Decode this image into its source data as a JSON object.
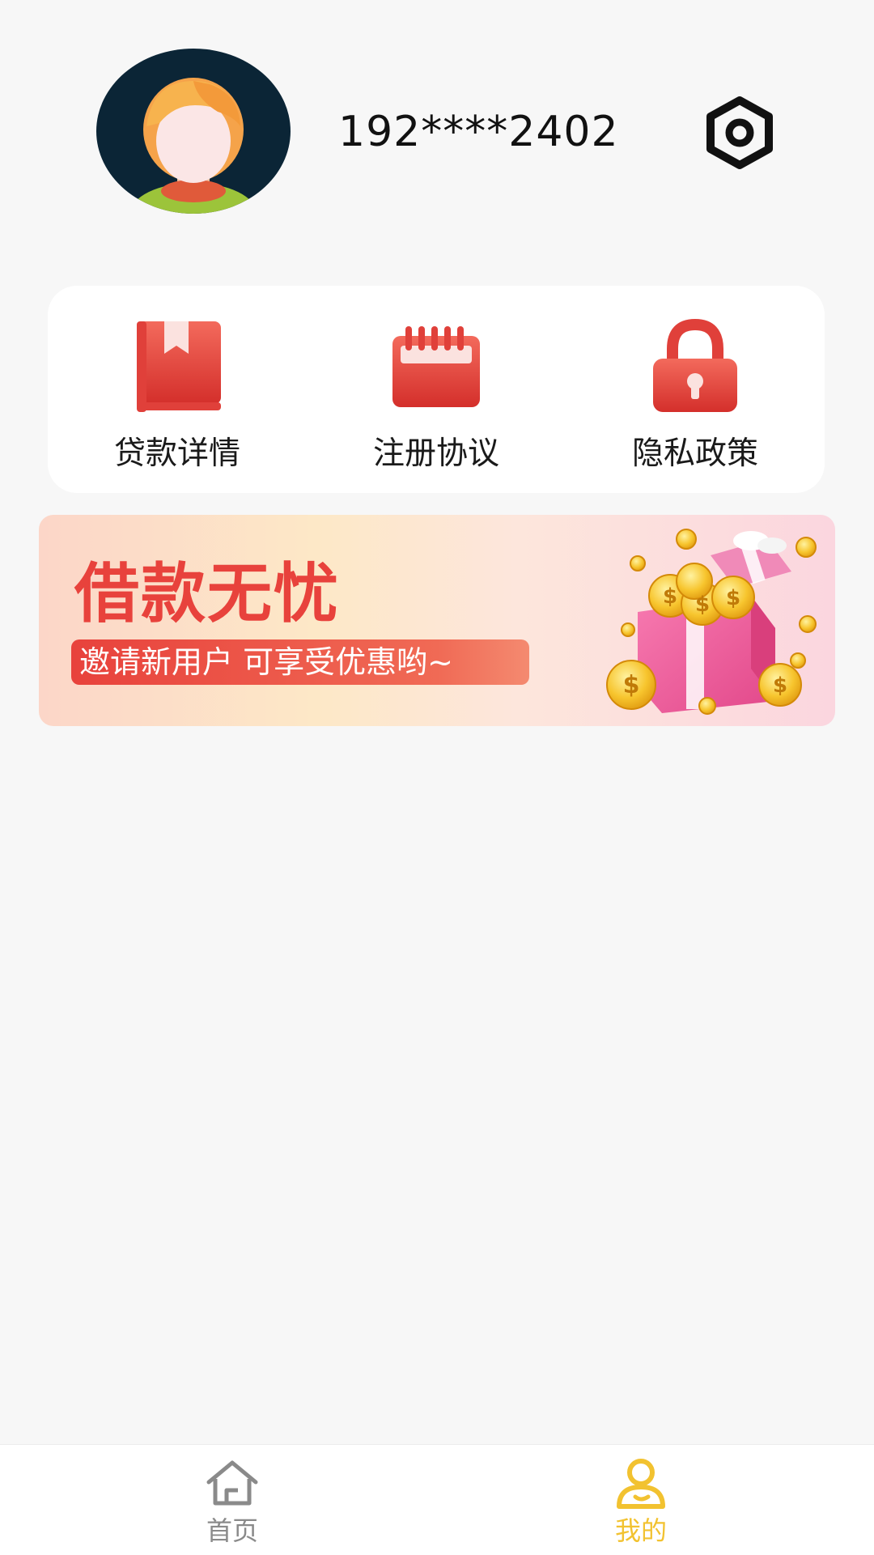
{
  "profile": {
    "phone": "192****2402",
    "avatar_icon": "avatar-icon",
    "settings_icon": "hexagon-settings-icon"
  },
  "quick_links": [
    {
      "label": "贷款详情",
      "icon": "book-icon"
    },
    {
      "label": "注册协议",
      "icon": "notepad-icon"
    },
    {
      "label": "隐私政策",
      "icon": "lock-icon"
    }
  ],
  "banner": {
    "title": "借款无忧",
    "subtitle": "邀请新用户 可享受优惠哟~",
    "image": "gift-box-coins-icon"
  },
  "tabbar": {
    "items": [
      {
        "label": "首页",
        "icon": "home-icon",
        "active": false
      },
      {
        "label": "我的",
        "icon": "user-icon",
        "active": true
      }
    ],
    "active_color": "#f2c230",
    "inactive_color": "#8a8a8a"
  },
  "colors": {
    "accent_red": "#e8423c",
    "background": "#f7f7f7"
  }
}
